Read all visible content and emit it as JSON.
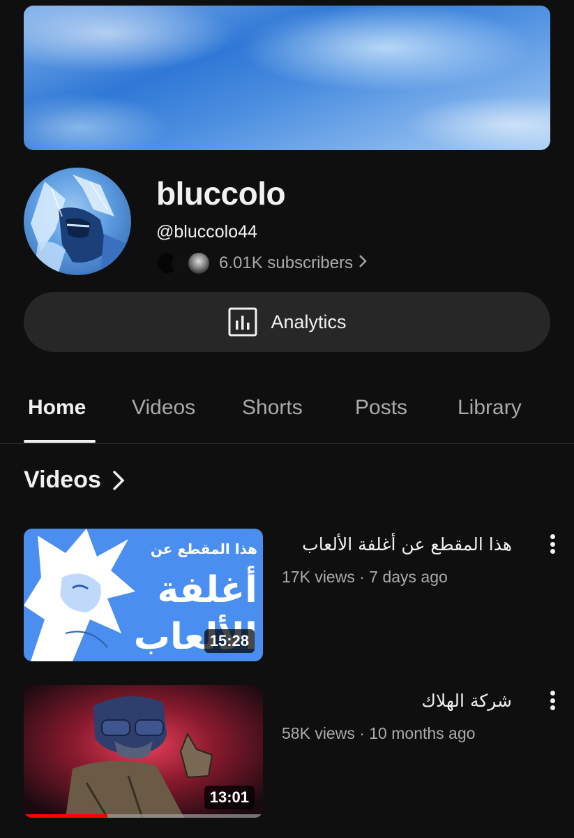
{
  "channel": {
    "name": "bluccolo",
    "handle": "@bluccolo44",
    "subscribers": "6.01K subscribers"
  },
  "analytics_button": {
    "label": "Analytics"
  },
  "tabs": [
    {
      "label": "Home",
      "active": true
    },
    {
      "label": "Videos",
      "active": false
    },
    {
      "label": "Shorts",
      "active": false
    },
    {
      "label": "Posts",
      "active": false
    },
    {
      "label": "Library",
      "active": false
    }
  ],
  "section": {
    "title": "Videos"
  },
  "videos": [
    {
      "title": "هذا المقطع عن أغلفة الألعاب",
      "meta": "17K views · 7 days ago",
      "duration": "15:28",
      "thumbnail_text_1": "هذا المقطع عن",
      "thumbnail_text_2": "أغلفة",
      "thumbnail_text_3": "الألعاب",
      "watch_progress": 0
    },
    {
      "title": "شركة الهلاك",
      "meta": "58K views · 10 months ago",
      "duration": "13:01",
      "watch_progress": 0.35
    }
  ],
  "colors": {
    "background": "#0f0f0f",
    "button_bg": "#272727",
    "secondary_text": "#aaaaaa",
    "progress_red": "#ff0000"
  },
  "icons": {
    "analytics": "bar-chart-icon",
    "chevron": "chevron-right-icon",
    "more": "more-vertical-icon"
  }
}
